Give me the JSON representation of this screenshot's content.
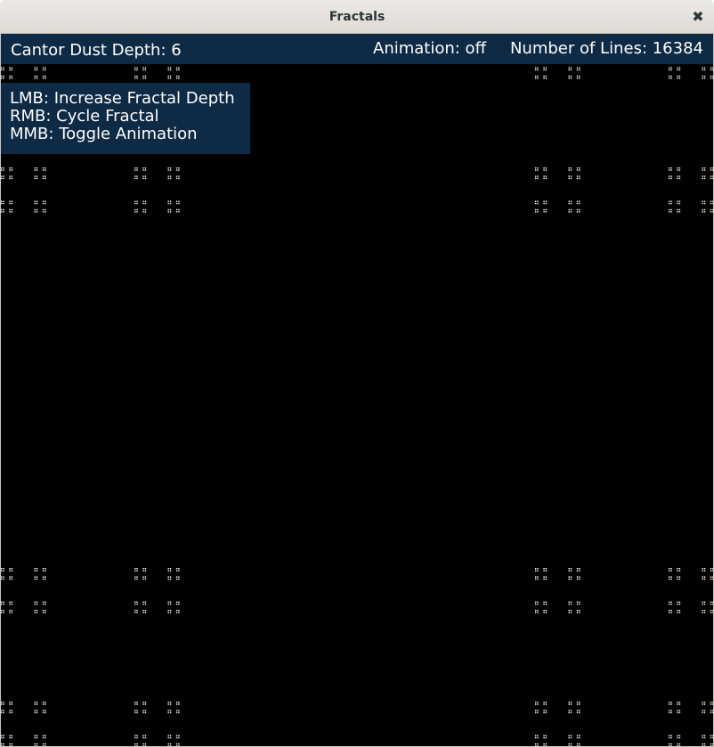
{
  "window": {
    "title": "Fractals",
    "close_icon": "close-icon"
  },
  "status": {
    "fractal_label": "Cantor Dust Depth: 6",
    "animation_label": "Animation: off",
    "lines_label": "Number of Lines: 16384"
  },
  "help": {
    "lines": [
      "LMB: Increase Fractal Depth",
      "RMB: Cycle Fractal",
      "MMB: Toggle Animation"
    ]
  },
  "fractal": {
    "type": "cantor-dust",
    "depth": 6,
    "background": "#000000",
    "foreground": "#ffffff",
    "panel_color": "#0e2a44"
  }
}
